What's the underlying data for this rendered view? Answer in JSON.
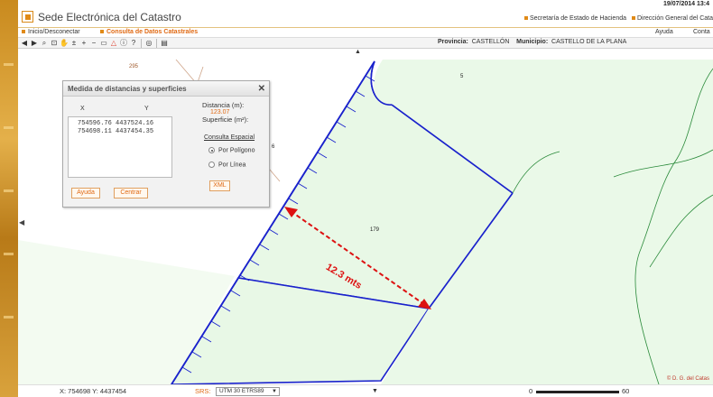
{
  "header": {
    "date": "19/07/2014 13:4",
    "title": "Sede Electrónica del Catastro",
    "links": [
      "Secretaría de Estado de Hacienda",
      "Dirección General del Cata"
    ]
  },
  "menu": {
    "home": "Inicio/Desconectar",
    "query": "Consulta de Datos Catastrales",
    "help": "Ayuda",
    "contact": "Conta"
  },
  "toolbar": {
    "icons": [
      "back-arrow-icon",
      "forward-arrow-icon",
      "zoom-magnifier-icon",
      "zoom-window-icon",
      "pan-hand-icon",
      "zoom-extent-icon",
      "zoom-in-icon",
      "zoom-out-icon",
      "measure-icon",
      "triangle-area-icon",
      "info-icon",
      "query-icon",
      "layers-icon",
      "marker-icon",
      "print-icon"
    ],
    "province_label": "Provincia:",
    "province_value": "CASTELLÓN",
    "municipality_label": "Municipio:",
    "municipality_value": "CASTELLO DE LA PLANA"
  },
  "map": {
    "parcel_labels": [
      "295",
      "5",
      "179",
      "6"
    ],
    "measure_annotation": "12.3 mts",
    "credit": "© D. G. del Catas",
    "colors": {
      "parcel_fill": "#e8f8e6",
      "parcel_border": "#1a22cc",
      "measure_line": "#dd1111",
      "neighbour_line": "#2a8a3a",
      "background_line": "#cfa58a"
    }
  },
  "dialog": {
    "title": "Medida de distancias y superficies",
    "col_x": "X",
    "col_y": "Y",
    "coordinates": [
      "754596.76 4437524.16",
      "754698.11 4437454.35"
    ],
    "distance_label": "Distancia (m):",
    "distance_value": "123.07",
    "surface_label": "Superficie (m²):",
    "spatial_query_title": "Consulta Espacial",
    "options": [
      {
        "label": "Por Polígono",
        "selected": true
      },
      {
        "label": "Por Línea",
        "selected": false
      }
    ],
    "xml_button": "XML",
    "help_button": "Ayuda",
    "center_button": "Centrar"
  },
  "status": {
    "cursor_coords": "X: 754698 Y: 4437454",
    "srs_label": "SRS:",
    "srs_value": "UTM 30 ETRS89",
    "scale_zero": "0",
    "scale_max": "60 m."
  }
}
